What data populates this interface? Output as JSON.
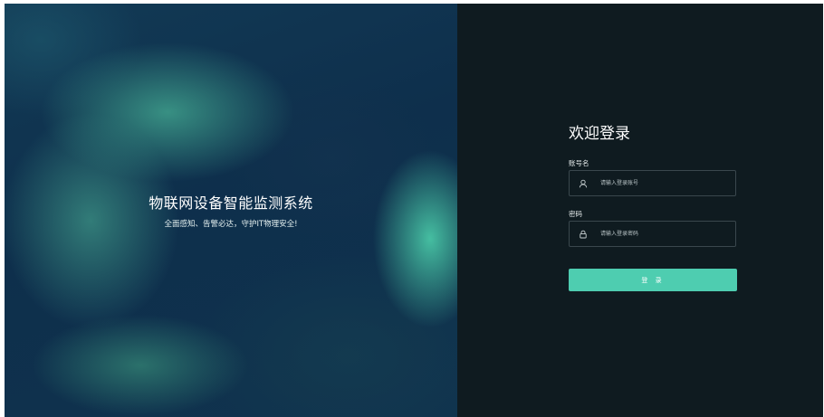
{
  "hero": {
    "title": "物联网设备智能监测系统",
    "subtitle": "全面感知、告警必达，守护IT物理安全!"
  },
  "login": {
    "heading": "欢迎登录",
    "username": {
      "label": "账号名",
      "placeholder": "请输入登录账号",
      "value": "",
      "icon": "user-icon"
    },
    "password": {
      "label": "密码",
      "placeholder": "请输入登录密码",
      "value": "",
      "icon": "lock-icon"
    },
    "submit_label": "登 录"
  },
  "colors": {
    "panel_background": "#0f1b20",
    "accent": "#4ecdb0",
    "hero_base": "#0f3350",
    "input_border": "#3a474d"
  }
}
